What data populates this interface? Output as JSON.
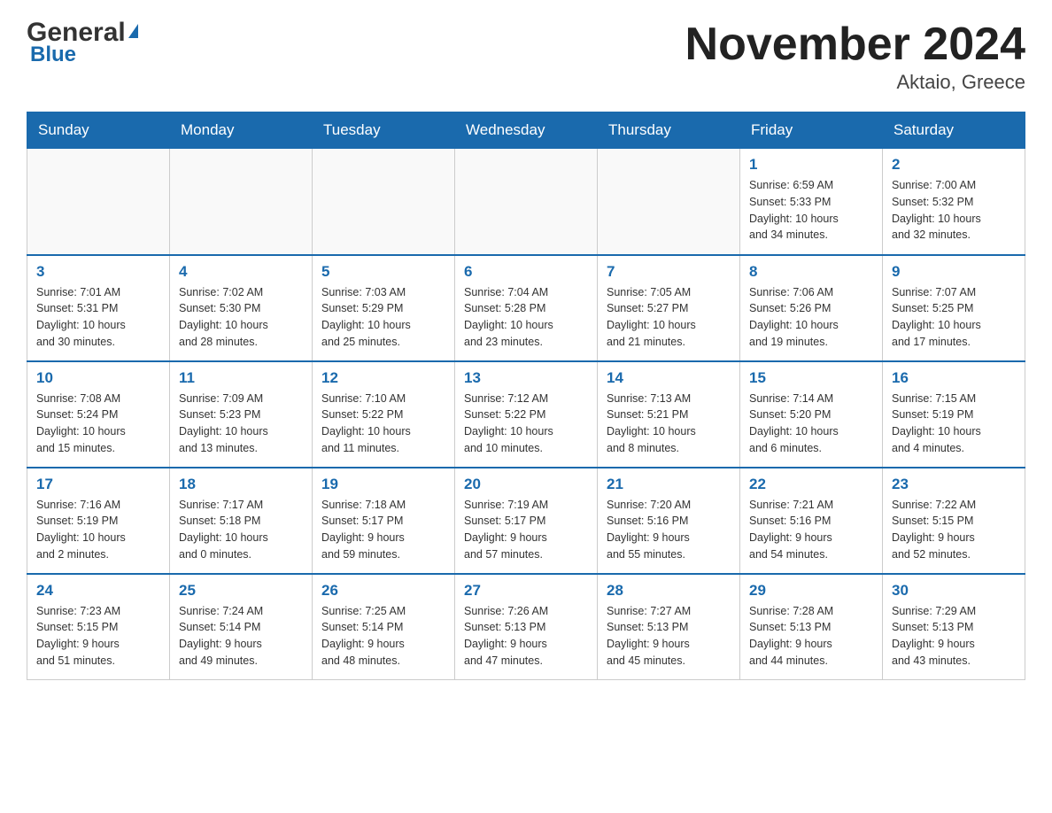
{
  "header": {
    "logo_general": "General",
    "logo_blue": "Blue",
    "month_title": "November 2024",
    "location": "Aktaio, Greece"
  },
  "days_of_week": [
    "Sunday",
    "Monday",
    "Tuesday",
    "Wednesday",
    "Thursday",
    "Friday",
    "Saturday"
  ],
  "weeks": [
    [
      {
        "day": "",
        "info": ""
      },
      {
        "day": "",
        "info": ""
      },
      {
        "day": "",
        "info": ""
      },
      {
        "day": "",
        "info": ""
      },
      {
        "day": "",
        "info": ""
      },
      {
        "day": "1",
        "info": "Sunrise: 6:59 AM\nSunset: 5:33 PM\nDaylight: 10 hours\nand 34 minutes."
      },
      {
        "day": "2",
        "info": "Sunrise: 7:00 AM\nSunset: 5:32 PM\nDaylight: 10 hours\nand 32 minutes."
      }
    ],
    [
      {
        "day": "3",
        "info": "Sunrise: 7:01 AM\nSunset: 5:31 PM\nDaylight: 10 hours\nand 30 minutes."
      },
      {
        "day": "4",
        "info": "Sunrise: 7:02 AM\nSunset: 5:30 PM\nDaylight: 10 hours\nand 28 minutes."
      },
      {
        "day": "5",
        "info": "Sunrise: 7:03 AM\nSunset: 5:29 PM\nDaylight: 10 hours\nand 25 minutes."
      },
      {
        "day": "6",
        "info": "Sunrise: 7:04 AM\nSunset: 5:28 PM\nDaylight: 10 hours\nand 23 minutes."
      },
      {
        "day": "7",
        "info": "Sunrise: 7:05 AM\nSunset: 5:27 PM\nDaylight: 10 hours\nand 21 minutes."
      },
      {
        "day": "8",
        "info": "Sunrise: 7:06 AM\nSunset: 5:26 PM\nDaylight: 10 hours\nand 19 minutes."
      },
      {
        "day": "9",
        "info": "Sunrise: 7:07 AM\nSunset: 5:25 PM\nDaylight: 10 hours\nand 17 minutes."
      }
    ],
    [
      {
        "day": "10",
        "info": "Sunrise: 7:08 AM\nSunset: 5:24 PM\nDaylight: 10 hours\nand 15 minutes."
      },
      {
        "day": "11",
        "info": "Sunrise: 7:09 AM\nSunset: 5:23 PM\nDaylight: 10 hours\nand 13 minutes."
      },
      {
        "day": "12",
        "info": "Sunrise: 7:10 AM\nSunset: 5:22 PM\nDaylight: 10 hours\nand 11 minutes."
      },
      {
        "day": "13",
        "info": "Sunrise: 7:12 AM\nSunset: 5:22 PM\nDaylight: 10 hours\nand 10 minutes."
      },
      {
        "day": "14",
        "info": "Sunrise: 7:13 AM\nSunset: 5:21 PM\nDaylight: 10 hours\nand 8 minutes."
      },
      {
        "day": "15",
        "info": "Sunrise: 7:14 AM\nSunset: 5:20 PM\nDaylight: 10 hours\nand 6 minutes."
      },
      {
        "day": "16",
        "info": "Sunrise: 7:15 AM\nSunset: 5:19 PM\nDaylight: 10 hours\nand 4 minutes."
      }
    ],
    [
      {
        "day": "17",
        "info": "Sunrise: 7:16 AM\nSunset: 5:19 PM\nDaylight: 10 hours\nand 2 minutes."
      },
      {
        "day": "18",
        "info": "Sunrise: 7:17 AM\nSunset: 5:18 PM\nDaylight: 10 hours\nand 0 minutes."
      },
      {
        "day": "19",
        "info": "Sunrise: 7:18 AM\nSunset: 5:17 PM\nDaylight: 9 hours\nand 59 minutes."
      },
      {
        "day": "20",
        "info": "Sunrise: 7:19 AM\nSunset: 5:17 PM\nDaylight: 9 hours\nand 57 minutes."
      },
      {
        "day": "21",
        "info": "Sunrise: 7:20 AM\nSunset: 5:16 PM\nDaylight: 9 hours\nand 55 minutes."
      },
      {
        "day": "22",
        "info": "Sunrise: 7:21 AM\nSunset: 5:16 PM\nDaylight: 9 hours\nand 54 minutes."
      },
      {
        "day": "23",
        "info": "Sunrise: 7:22 AM\nSunset: 5:15 PM\nDaylight: 9 hours\nand 52 minutes."
      }
    ],
    [
      {
        "day": "24",
        "info": "Sunrise: 7:23 AM\nSunset: 5:15 PM\nDaylight: 9 hours\nand 51 minutes."
      },
      {
        "day": "25",
        "info": "Sunrise: 7:24 AM\nSunset: 5:14 PM\nDaylight: 9 hours\nand 49 minutes."
      },
      {
        "day": "26",
        "info": "Sunrise: 7:25 AM\nSunset: 5:14 PM\nDaylight: 9 hours\nand 48 minutes."
      },
      {
        "day": "27",
        "info": "Sunrise: 7:26 AM\nSunset: 5:13 PM\nDaylight: 9 hours\nand 47 minutes."
      },
      {
        "day": "28",
        "info": "Sunrise: 7:27 AM\nSunset: 5:13 PM\nDaylight: 9 hours\nand 45 minutes."
      },
      {
        "day": "29",
        "info": "Sunrise: 7:28 AM\nSunset: 5:13 PM\nDaylight: 9 hours\nand 44 minutes."
      },
      {
        "day": "30",
        "info": "Sunrise: 7:29 AM\nSunset: 5:13 PM\nDaylight: 9 hours\nand 43 minutes."
      }
    ]
  ]
}
